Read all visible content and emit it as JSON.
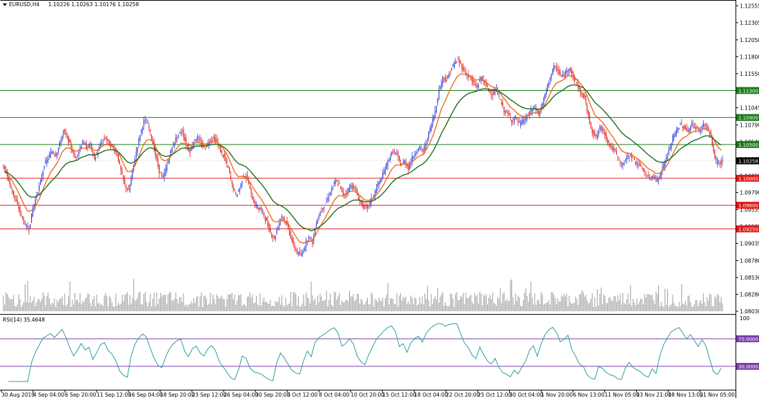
{
  "chart_data": {
    "type": "candlestick",
    "symbol": "EURUSD,H4",
    "ohlc_header": "1.10226 1.10263 1.10176 1.10258",
    "price_axis": {
      "range": [
        1.0803,
        1.126
      ],
      "ticks": [
        "1.12555",
        "1.12305",
        "1.12050",
        "1.11800",
        "1.11550",
        "1.11300",
        "1.11045",
        "1.10790",
        "1.10540",
        "1.10285",
        "1.10035",
        "1.09790",
        "1.09535",
        "1.09285",
        "1.09035",
        "1.08780",
        "1.08530",
        "1.08280",
        "1.08030"
      ]
    },
    "time_axis": {
      "labels": [
        "30 Aug 2019",
        "4 Sep 04:00",
        "6 Sep 20:00",
        "11 Sep 12:00",
        "16 Sep 04:00",
        "18 Sep 20:00",
        "23 Sep 12:00",
        "26 Sep 04:00",
        "30 Sep 20:00",
        "3 Oct 12:00",
        "8 Oct 04:00",
        "10 Oct 20:00",
        "15 Oct 12:00",
        "18 Oct 04:00",
        "22 Oct 20:00",
        "25 Oct 12:00",
        "30 Oct 04:00",
        "1 Nov 20:00",
        "6 Nov 13:00",
        "11 Nov 05:00",
        "13 Nov 21:00",
        "18 Nov 13:00",
        "21 Nov 05:00"
      ]
    },
    "current_price": "1.10258",
    "levels": [
      {
        "price": 1.113,
        "label": "1.11300",
        "color": "#1a7a1a"
      },
      {
        "price": 1.109,
        "label": "1.10900",
        "color": "#1a7a1a"
      },
      {
        "price": 1.105,
        "label": "1.10500",
        "color": "#1a7a1a"
      },
      {
        "price": 1.1,
        "label": "1.10000",
        "color": "#e01818"
      },
      {
        "price": 1.096,
        "label": "1.09600",
        "color": "#e01818"
      },
      {
        "price": 1.0925,
        "label": "1.09250",
        "color": "#e01818"
      }
    ],
    "closes": [
      1.101,
      1.099,
      1.0975,
      1.096,
      1.0945,
      1.093,
      1.0925,
      1.0955,
      1.0975,
      1.0995,
      1.102,
      1.103,
      1.104,
      1.1035,
      1.105,
      1.107,
      1.106,
      1.1045,
      1.103,
      1.104,
      1.1055,
      1.1045,
      1.105,
      1.103,
      1.104,
      1.1055,
      1.106,
      1.105,
      1.1045,
      1.1035,
      1.101,
      1.099,
      1.098,
      1.101,
      1.104,
      1.1065,
      1.1085,
      1.108,
      1.106,
      1.1035,
      1.101,
      1.1,
      1.102,
      1.104,
      1.1055,
      1.1065,
      1.107,
      1.105,
      1.104,
      1.1055,
      1.106,
      1.105,
      1.1045,
      1.1055,
      1.106,
      1.1055,
      1.104,
      1.103,
      1.1015,
      1.099,
      1.0975,
      1.0985,
      1.1005,
      1.1,
      1.0975,
      1.096,
      1.0955,
      1.095,
      1.0935,
      1.092,
      1.091,
      1.093,
      1.0945,
      1.0935,
      1.092,
      1.09,
      1.089,
      1.0885,
      1.09,
      1.0915,
      1.0905,
      1.0935,
      1.095,
      1.096,
      1.097,
      1.0985,
      1.0995,
      1.099,
      1.0975,
      1.098,
      1.099,
      1.0985,
      1.097,
      1.096,
      1.0955,
      1.0965,
      1.0975,
      1.099,
      1.1,
      1.1015,
      1.103,
      1.104,
      1.1035,
      1.102,
      1.1025,
      1.1015,
      1.103,
      1.104,
      1.1045,
      1.104,
      1.106,
      1.108,
      1.11,
      1.113,
      1.115,
      1.1145,
      1.116,
      1.117,
      1.1175,
      1.1165,
      1.1155,
      1.115,
      1.114,
      1.1135,
      1.115,
      1.114,
      1.113,
      1.1125,
      1.113,
      1.1115,
      1.11,
      1.1095,
      1.1085,
      1.109,
      1.108,
      1.1085,
      1.109,
      1.11,
      1.1105,
      1.1095,
      1.111,
      1.113,
      1.115,
      1.1165,
      1.116,
      1.115,
      1.1155,
      1.1165,
      1.115,
      1.114,
      1.1125,
      1.112,
      1.109,
      1.107,
      1.106,
      1.1075,
      1.107,
      1.1055,
      1.1045,
      1.104,
      1.1025,
      1.102,
      1.103,
      1.1035,
      1.1025,
      1.102,
      1.1015,
      1.1005,
      1.1,
      1.1005,
      1.0995,
      1.101,
      1.1025,
      1.104,
      1.106,
      1.107,
      1.108,
      1.1075,
      1.107,
      1.108,
      1.1075,
      1.107,
      1.108,
      1.1075,
      1.106,
      1.103,
      1.102,
      1.1026
    ],
    "volume_scale_note": "",
    "rsi": {
      "label": "RSI(14) 35.4648",
      "range": [
        0,
        100
      ],
      "ticks": [
        "100",
        "70.0000",
        "30.0000",
        "0"
      ],
      "levels": [
        70,
        30
      ]
    }
  }
}
